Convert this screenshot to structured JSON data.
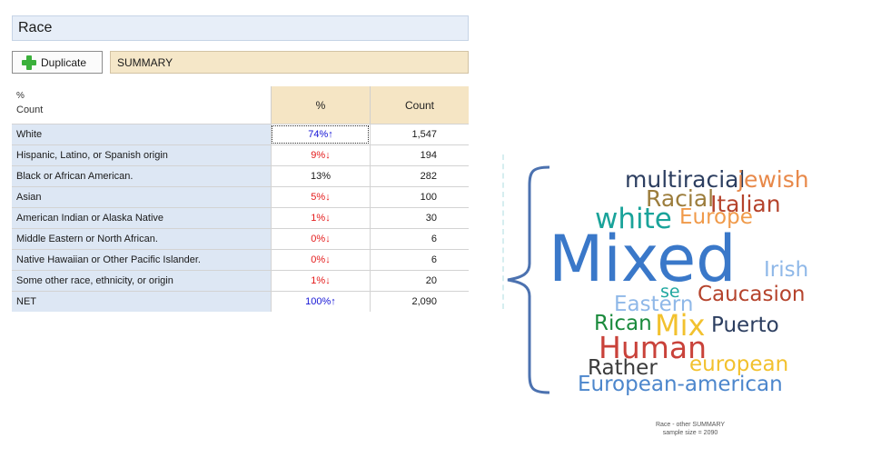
{
  "panel": {
    "title": "Race",
    "duplicate_label": "Duplicate",
    "summary_label": "SUMMARY"
  },
  "table": {
    "stat_labels": [
      "%",
      "Count"
    ],
    "columns": [
      "%",
      "Count"
    ],
    "rows": [
      {
        "label": "White",
        "pct": "74%↑",
        "count": "1,547",
        "sig": "up"
      },
      {
        "label": "Hispanic, Latino, or Spanish origin",
        "pct": "9%↓",
        "count": "194",
        "sig": "down"
      },
      {
        "label": "Black or African American.",
        "pct": "13%",
        "count": "282",
        "sig": "none"
      },
      {
        "label": "Asian",
        "pct": "5%↓",
        "count": "100",
        "sig": "down"
      },
      {
        "label": "American Indian or Alaska Native",
        "pct": "1%↓",
        "count": "30",
        "sig": "down"
      },
      {
        "label": "Middle Eastern or North African.",
        "pct": "0%↓",
        "count": "6",
        "sig": "down"
      },
      {
        "label": "Native Hawaiian or Other Pacific Islander.",
        "pct": "0%↓",
        "count": "6",
        "sig": "down"
      },
      {
        "label": "Some other race, ethnicity, or origin",
        "pct": "1%↓",
        "count": "20",
        "sig": "down"
      },
      {
        "label": "NET",
        "pct": "100%↑",
        "count": "2,090",
        "sig": "up"
      }
    ],
    "colors": {
      "up": "#1515d6",
      "down": "#e41b1b",
      "header_bg": "#f5e5c4",
      "row_bg": "#dde7f4"
    }
  },
  "word_cloud": {
    "words": [
      {
        "text": "multiracial",
        "color": "#2c3e60"
      },
      {
        "text": "jewish",
        "color": "#e8894a"
      },
      {
        "text": "Racial",
        "color": "#9c7d3c"
      },
      {
        "text": "Italian",
        "color": "#b5432c"
      },
      {
        "text": "white",
        "color": "#1aa39a"
      },
      {
        "text": "Europe",
        "color": "#f09a4a"
      },
      {
        "text": "Mixed",
        "color": "#3a78c9"
      },
      {
        "text": "Irish",
        "color": "#8fb8e8"
      },
      {
        "text": "se",
        "color": "#22a8a0"
      },
      {
        "text": "Eastern",
        "color": "#8fb8e8"
      },
      {
        "text": "Caucasion",
        "color": "#b5432c"
      },
      {
        "text": "Rican",
        "color": "#1a8a3c"
      },
      {
        "text": "Mix",
        "color": "#f2c12e"
      },
      {
        "text": "Puerto",
        "color": "#2c3e60"
      },
      {
        "text": "Human",
        "color": "#c9423a"
      },
      {
        "text": "Rather",
        "color": "#3b3b3b"
      },
      {
        "text": "european",
        "color": "#f2c12e"
      },
      {
        "text": "European-american",
        "color": "#4c86cc"
      }
    ],
    "brace_color": "#4c72b0",
    "caption_line1": "Race - other SUMMARY",
    "caption_line2": "sample size = 2090"
  }
}
